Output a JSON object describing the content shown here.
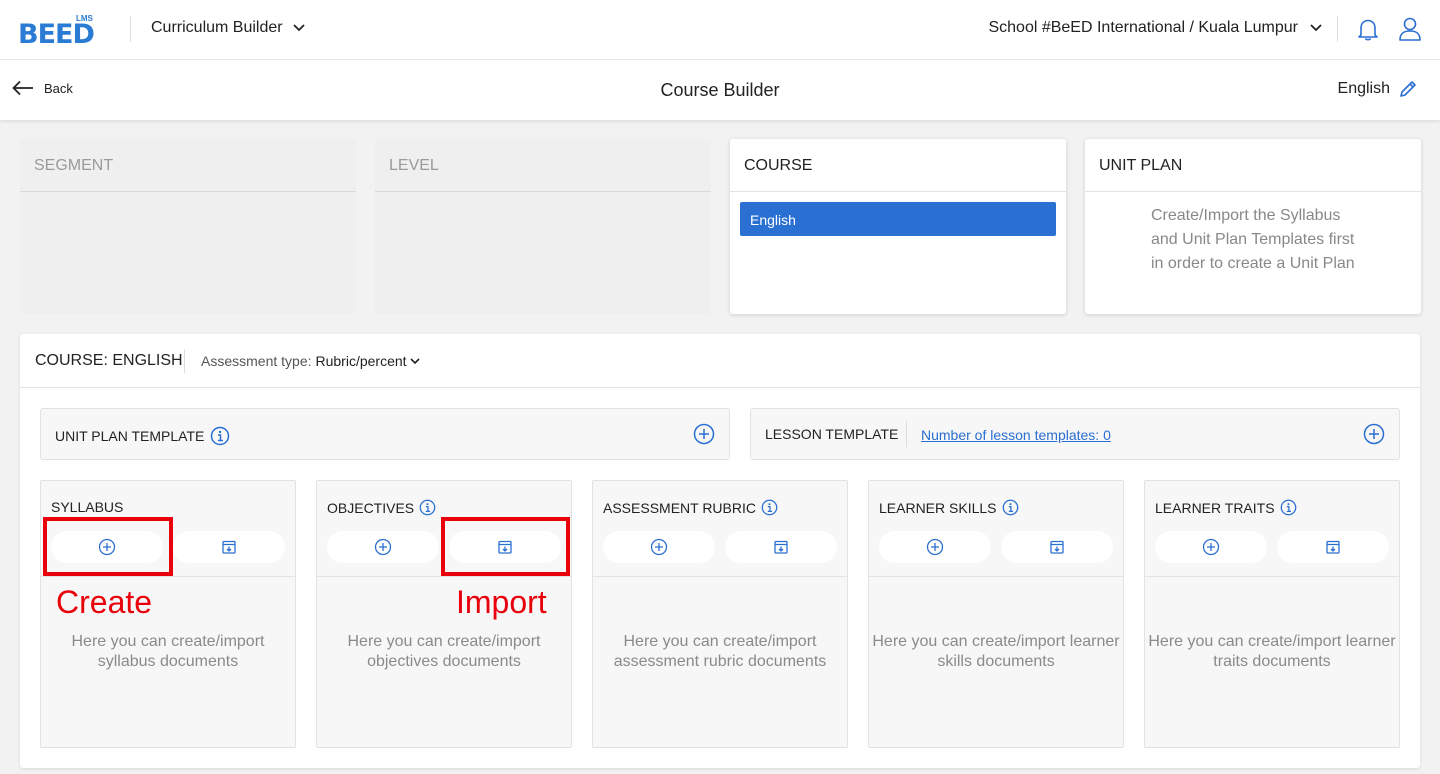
{
  "header": {
    "logo_small": "LMS",
    "logo_main": "BEED",
    "app_switcher": "Curriculum Builder",
    "school_switcher": "School #BeED International / Kuala Lumpur"
  },
  "subheader": {
    "back_label": "Back",
    "title": "Course Builder",
    "language": "English"
  },
  "cards": {
    "segment": {
      "title": "SEGMENT"
    },
    "level": {
      "title": "LEVEL"
    },
    "course": {
      "title": "COURSE",
      "selected_item": "English"
    },
    "unit_plan": {
      "title": "UNIT PLAN",
      "hint": "Create/Import the Syllabus and Unit Plan Templates first in order to create a Unit Plan"
    }
  },
  "panel": {
    "course_label": "COURSE: ENGLISH",
    "assessment_label": "Assessment type:",
    "assessment_value": "Rubric/percent",
    "unit_plan_template": "UNIT PLAN TEMPLATE",
    "lesson_template": "LESSON TEMPLATE",
    "lesson_template_link": "Number of lesson templates: 0",
    "columns": [
      {
        "title": "SYLLABUS",
        "text": "Here you can create/import syllabus documents"
      },
      {
        "title": "OBJECTIVES",
        "text": "Here you can create/import objectives documents"
      },
      {
        "title": "ASSESSMENT RUBRIC",
        "text": "Here you can create/import assessment rubric documents"
      },
      {
        "title": "LEARNER SKILLS",
        "text": "Here you can create/import learner skills documents"
      },
      {
        "title": "LEARNER TRAITS",
        "text": "Here you can create/import learner traits documents"
      }
    ]
  },
  "annotations": {
    "create": "Create",
    "import": "Import"
  },
  "colors": {
    "accent": "#2a6fd2",
    "annotation": "#e8000b"
  }
}
